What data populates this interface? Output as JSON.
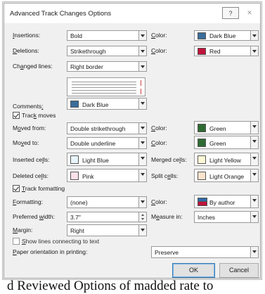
{
  "dialog": {
    "title": "Advanced Track Changes Options",
    "help_label": "?",
    "close_label": "✕"
  },
  "colors": {
    "dark_blue": "#3b6d9a",
    "red": "#c0143c",
    "green": "#2e6b33",
    "light_blue": "#e8f4fb",
    "pink": "#fde0ea",
    "light_yellow": "#fff8d6",
    "light_orange": "#fde4cc",
    "author_red": "#c0143c",
    "author_blue": "#2f6aa8"
  },
  "markup": {
    "insertions_label": "Insertions:",
    "insertions_value": "Bold",
    "insertions_color_label": "Color:",
    "insertions_color_value": "Dark Blue",
    "deletions_label": "Deletions:",
    "deletions_value": "Strikethrough",
    "deletions_color_label": "Color:",
    "deletions_color_value": "Red",
    "changed_lines_label": "Changed lines:",
    "changed_lines_value": "Right border",
    "comments_label": "Comments:",
    "comments_value": "Dark Blue"
  },
  "moves": {
    "track_moves_label": "Track moves",
    "track_moves_checked": true,
    "moved_from_label": "Moved from:",
    "moved_from_value": "Double strikethrough",
    "moved_from_color_label": "Color:",
    "moved_from_color_value": "Green",
    "moved_to_label": "Moved to:",
    "moved_to_value": "Double underline",
    "moved_to_color_label": "Color:",
    "moved_to_color_value": "Green"
  },
  "cells": {
    "inserted_label": "Inserted cells:",
    "inserted_value": "Light Blue",
    "merged_label": "Merged cells:",
    "merged_value": "Light Yellow",
    "deleted_label": "Deleted cells:",
    "deleted_value": "Pink",
    "split_label": "Split cells:",
    "split_value": "Light Orange"
  },
  "formatting": {
    "track_formatting_label": "Track formatting",
    "track_formatting_checked": true,
    "formatting_label": "Formatting:",
    "formatting_value": "(none)",
    "formatting_color_label": "Color:",
    "formatting_color_value": "By author"
  },
  "balloons": {
    "preferred_width_label": "Preferred width:",
    "preferred_width_value": "3.7\"",
    "measure_in_label": "Measure in:",
    "measure_in_value": "Inches",
    "margin_label": "Margin:",
    "margin_value": "Right",
    "show_lines_label": "Show lines connecting to text",
    "show_lines_checked": false,
    "paper_orientation_label": "Paper orientation in printing:",
    "paper_orientation_value": "Preserve"
  },
  "buttons": {
    "ok": "OK",
    "cancel": "Cancel"
  },
  "background_text": "d Reviewed Options of madded rate to"
}
